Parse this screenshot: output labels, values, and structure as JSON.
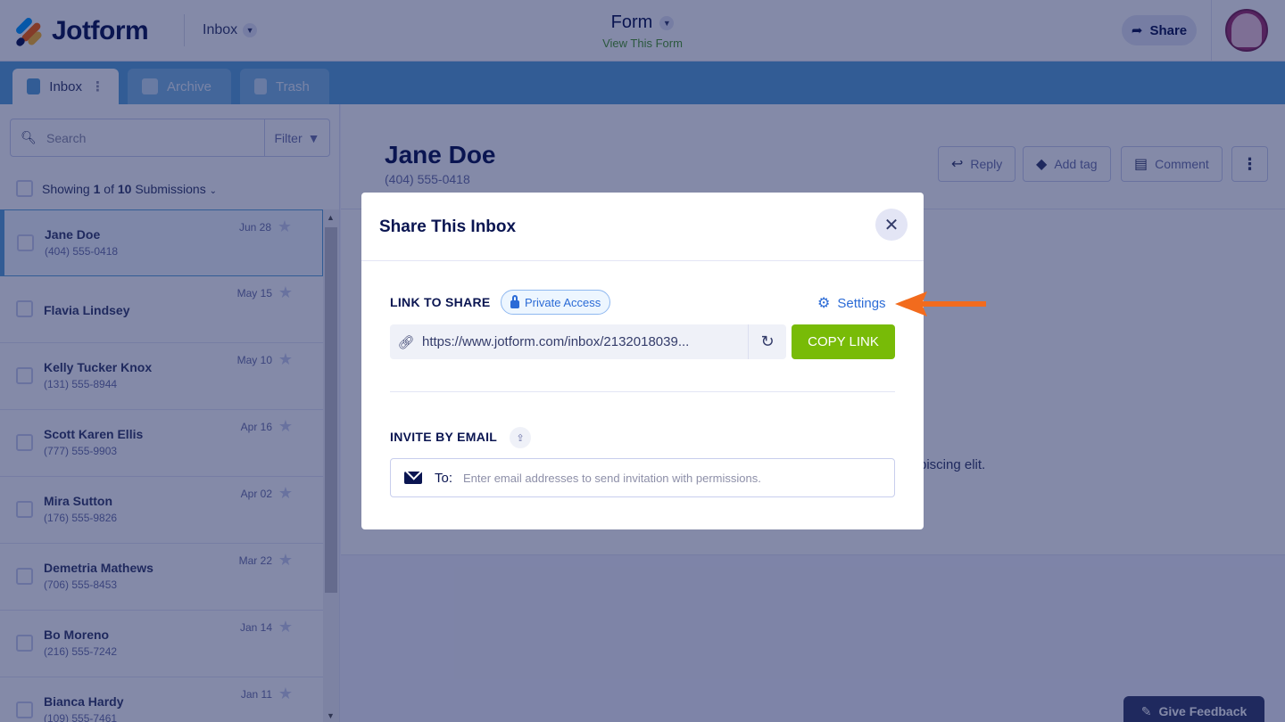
{
  "header": {
    "logo_text": "Jotform",
    "inbox_label": "Inbox",
    "form_title": "Form",
    "form_subtitle": "View This Form",
    "share_label": "Share"
  },
  "tabs": [
    {
      "label": "Inbox",
      "active": true
    },
    {
      "label": "Archive",
      "active": false
    },
    {
      "label": "Trash",
      "active": false
    }
  ],
  "sidebar": {
    "search_placeholder": "Search",
    "filter_label": "Filter",
    "showing_prefix": "Showing ",
    "showing_count": "1",
    "showing_of": " of ",
    "showing_total": "10",
    "showing_suffix": " Submissions",
    "submissions": [
      {
        "name": "Jane Doe",
        "phone": "(404) 555-0418",
        "date": "Jun 28",
        "selected": true
      },
      {
        "name": "Flavia Lindsey",
        "phone": "",
        "date": "May 15"
      },
      {
        "name": "Kelly Tucker Knox",
        "phone": "(131) 555-8944",
        "date": "May 10"
      },
      {
        "name": "Scott Karen Ellis",
        "phone": "(777) 555-9903",
        "date": "Apr 16"
      },
      {
        "name": "Mira Sutton",
        "phone": "(176) 555-9826",
        "date": "Apr 02"
      },
      {
        "name": "Demetria Mathews",
        "phone": "(706) 555-8453",
        "date": "Mar 22"
      },
      {
        "name": "Bo Moreno",
        "phone": "(216) 555-7242",
        "date": "Jan 14"
      },
      {
        "name": "Bianca Hardy",
        "phone": "(109) 555-7461",
        "date": "Jan 11"
      }
    ]
  },
  "detail": {
    "name": "Jane Doe",
    "phone": "(404) 555-0418",
    "reply_label": "Reply",
    "add_tag_label": "Add tag",
    "comment_label": "Comment",
    "body_fragment": "piscing elit."
  },
  "feedback_label": "Give Feedback",
  "modal": {
    "title": "Share This Inbox",
    "link_label": "LINK TO SHARE",
    "access_badge": "Private Access",
    "settings_label": "Settings",
    "url": "https://www.jotform.com/inbox/2132018039...",
    "copy_label": "COPY LINK",
    "invite_label": "INVITE BY EMAIL",
    "to_label": "To:",
    "email_placeholder": "Enter email addresses to send invitation with permissions."
  },
  "colors": {
    "accent_blue": "#5ba3d9",
    "copy_green": "#78bb07",
    "arrow_orange": "#f26b1d",
    "navy": "#0a1551"
  }
}
